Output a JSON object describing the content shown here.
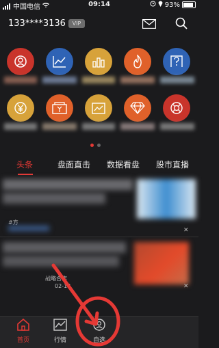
{
  "status_bar": {
    "carrier": "中国电信",
    "time": "09:14",
    "battery": "93%"
  },
  "header": {
    "account": "133****3136",
    "vip_badge": "VIP"
  },
  "tabs": [
    {
      "label": "头条",
      "active": true
    },
    {
      "label": "盘面直击",
      "active": false
    },
    {
      "label": "数据看盘",
      "active": false
    },
    {
      "label": "股市直播",
      "active": false
    }
  ],
  "news": [
    {
      "tag": "#方",
      "source": ""
    },
    {
      "tag": "",
      "source": "战略合作",
      "time": "02-13"
    }
  ],
  "bottom_nav": [
    {
      "label": "首页",
      "icon": "home-icon",
      "active": true
    },
    {
      "label": "行情",
      "icon": "chart-icon",
      "active": false
    },
    {
      "label": "自选",
      "icon": "user-star-icon",
      "active": false
    }
  ],
  "colors": {
    "accent": "#e53935",
    "background": "#1b1b1d",
    "circle_red": "#c9342b",
    "circle_blue": "#2f63b5",
    "circle_gold": "#d7a23a",
    "circle_orange": "#e0612a"
  }
}
